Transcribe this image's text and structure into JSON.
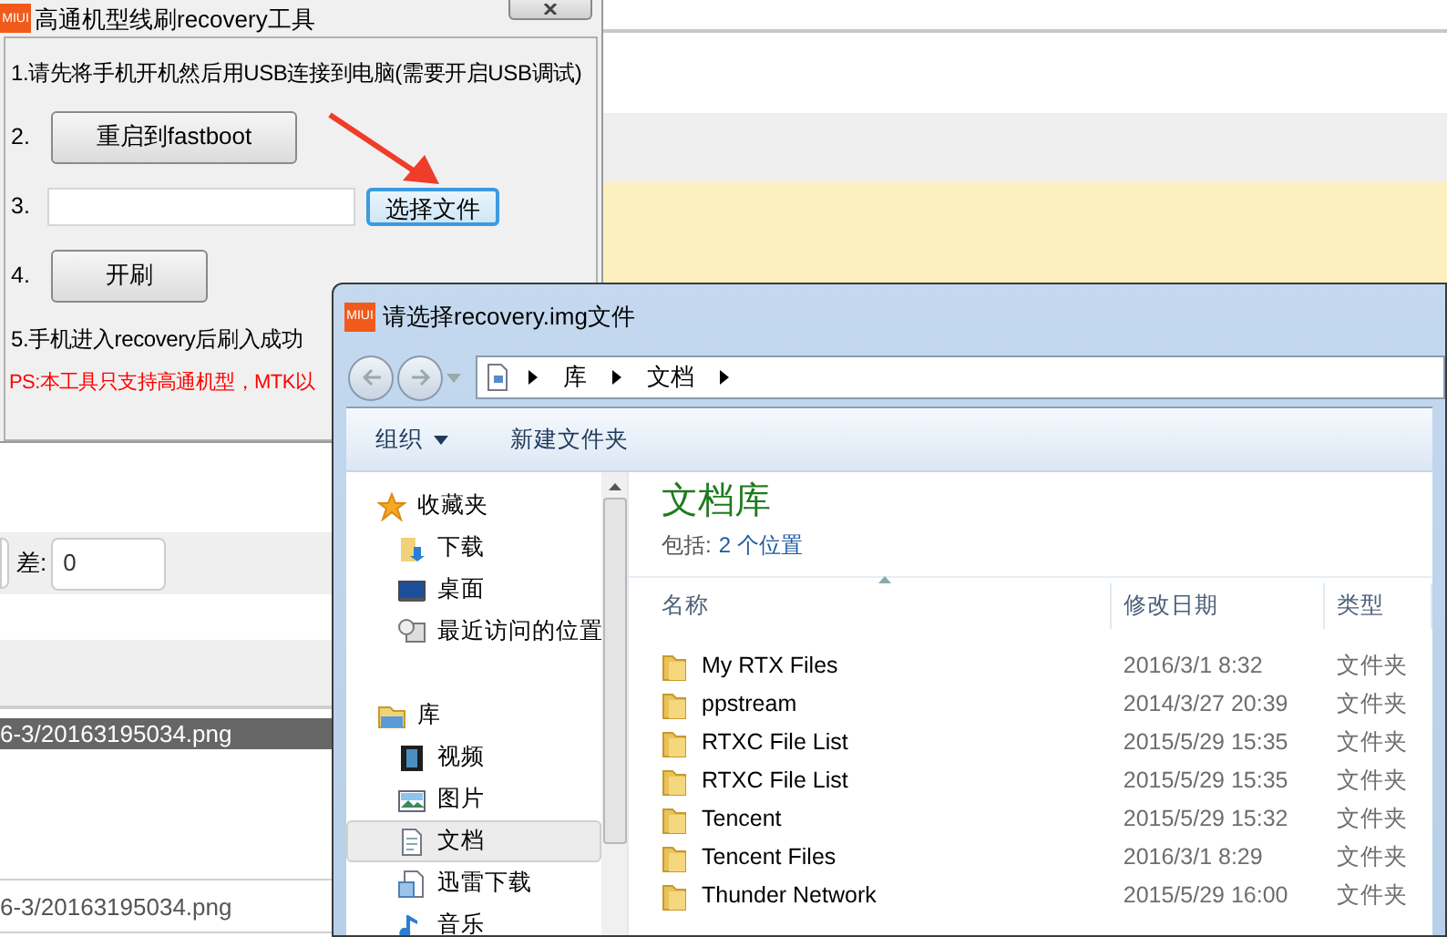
{
  "background_page": {
    "filter_label": "差:",
    "filter_value": "0",
    "file_rows": [
      {
        "text": "6-3/20163195034.png",
        "selected": true
      },
      {
        "text": "6-3/20163195034.png",
        "selected": false
      }
    ]
  },
  "tool_window": {
    "logo_text": "MIUI",
    "title": "高通机型线刷recovery工具",
    "steps": [
      {
        "kind": "text",
        "text": "1.请先将手机开机然后用USB连接到电脑(需要开启USB调试)"
      },
      {
        "kind": "button",
        "number": "2.",
        "button": "重启到fastboot"
      },
      {
        "kind": "file",
        "number": "3.",
        "button": "选择文件",
        "focused": true
      },
      {
        "kind": "button",
        "number": "4.",
        "button": "开刷"
      },
      {
        "kind": "text",
        "text": "5.手机进入recovery后刷入成功"
      }
    ],
    "note": "PS:本工具只支持高通机型，MTK以"
  },
  "file_dialog": {
    "logo_text": "MIUI",
    "title": "请选择recovery.img文件",
    "breadcrumb": [
      "库",
      "文档"
    ],
    "toolbar": [
      {
        "label": "组织",
        "dropdown": true
      },
      {
        "label": "新建文件夹",
        "dropdown": false
      }
    ],
    "nav": [
      {
        "label": "收藏夹",
        "kind": "favorites",
        "selected": false,
        "children": [
          {
            "label": "下载",
            "kind": "download",
            "selected": false
          },
          {
            "label": "桌面",
            "kind": "desktop",
            "selected": false
          },
          {
            "label": "最近访问的位置",
            "kind": "recent",
            "selected": false
          }
        ]
      },
      {
        "label": "库",
        "kind": "library",
        "selected": false,
        "children": [
          {
            "label": "视频",
            "kind": "video",
            "selected": false
          },
          {
            "label": "图片",
            "kind": "picture",
            "selected": false
          },
          {
            "label": "文档",
            "kind": "document",
            "selected": true
          },
          {
            "label": "迅雷下载",
            "kind": "thunder",
            "selected": false
          },
          {
            "label": "音乐",
            "kind": "music",
            "selected": false
          }
        ]
      }
    ],
    "library_title": "文档库",
    "includes_label": "包括:",
    "includes_link": "2 个位置",
    "columns": [
      "名称",
      "修改日期",
      "类型"
    ],
    "rows": [
      {
        "name": "My RTX Files",
        "date": "2016/3/1 8:32",
        "type": "文件夹"
      },
      {
        "name": "ppstream",
        "date": "2014/3/27 20:39",
        "type": "文件夹"
      },
      {
        "name": "RTXC File List",
        "date": "2015/5/29 15:35",
        "type": "文件夹"
      },
      {
        "name": "RTXC File List",
        "date": "2015/5/29 15:35",
        "type": "文件夹"
      },
      {
        "name": "Tencent",
        "date": "2015/5/29 15:32",
        "type": "文件夹"
      },
      {
        "name": "Tencent Files",
        "date": "2016/3/1 8:29",
        "type": "文件夹"
      },
      {
        "name": "Thunder Network",
        "date": "2015/5/29 16:00",
        "type": "文件夹"
      }
    ]
  }
}
